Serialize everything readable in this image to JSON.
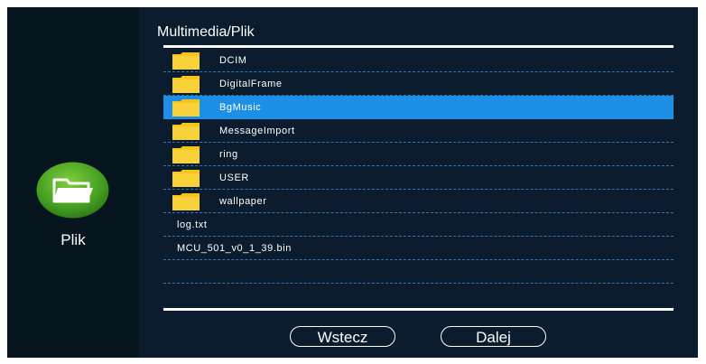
{
  "sidebar": {
    "app_label": "Plik",
    "icon": "folder-open-icon"
  },
  "header": {
    "path": "Multimedia/Plik"
  },
  "list": {
    "items": [
      {
        "name": "DCIM",
        "type": "folder",
        "selected": false
      },
      {
        "name": "DigitalFrame",
        "type": "folder",
        "selected": false
      },
      {
        "name": "BgMusic",
        "type": "folder",
        "selected": true
      },
      {
        "name": "MessageImport",
        "type": "folder",
        "selected": false
      },
      {
        "name": "ring",
        "type": "folder",
        "selected": false
      },
      {
        "name": "USER",
        "type": "folder",
        "selected": false
      },
      {
        "name": "wallpaper",
        "type": "folder",
        "selected": false
      },
      {
        "name": "log.txt",
        "type": "file",
        "selected": false
      },
      {
        "name": "MCU_501_v0_1_39.bin",
        "type": "file",
        "selected": false
      }
    ]
  },
  "buttons": {
    "back_label": "Wstecz",
    "next_label": "Dalej"
  },
  "colors": {
    "selected_row": "#1e8fe6",
    "folder": "#f7c51a",
    "app_icon": "#4a9b1e"
  }
}
